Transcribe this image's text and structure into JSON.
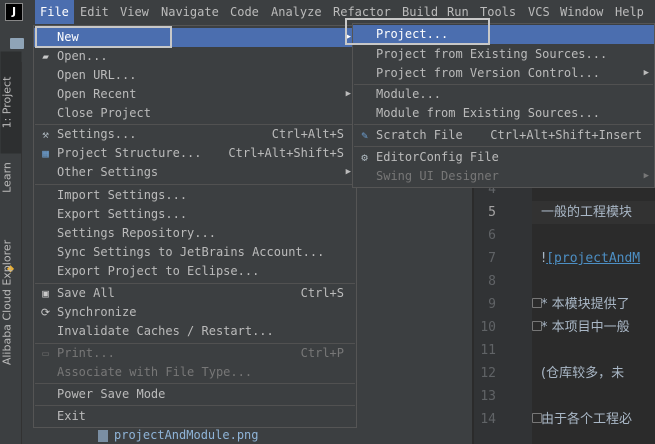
{
  "app": {
    "icon_letter": "J"
  },
  "menubar": {
    "items": [
      "File",
      "Edit",
      "View",
      "Navigate",
      "Code",
      "Analyze",
      "Refactor",
      "Build",
      "Run",
      "Tools",
      "VCS",
      "Window",
      "Help"
    ]
  },
  "toolwindows": {
    "project_tab": "1: Project",
    "learn_tab": "Learn",
    "alibaba_tab": "Alibaba Cloud Explorer"
  },
  "project_panel": {
    "file_name": "projectAndModule.png"
  },
  "file_menu": {
    "items": [
      {
        "label": "New",
        "shortcut": "",
        "submenu": true,
        "icon": "",
        "disabled": false,
        "highlighted": true
      },
      {
        "label": "Open...",
        "shortcut": "",
        "submenu": false,
        "icon": "folder-open-icon",
        "disabled": false
      },
      {
        "label": "Open URL...",
        "shortcut": "",
        "submenu": false,
        "icon": "",
        "disabled": false
      },
      {
        "label": "Open Recent",
        "shortcut": "",
        "submenu": true,
        "icon": "",
        "disabled": false
      },
      {
        "label": "Close Project",
        "shortcut": "",
        "submenu": false,
        "icon": "",
        "disabled": false
      },
      {
        "label": "Settings...",
        "shortcut": "Ctrl+Alt+S",
        "submenu": false,
        "icon": "wrench-icon",
        "disabled": false
      },
      {
        "label": "Project Structure...",
        "shortcut": "Ctrl+Alt+Shift+S",
        "submenu": false,
        "icon": "project-structure-icon",
        "disabled": false
      },
      {
        "label": "Other Settings",
        "shortcut": "",
        "submenu": true,
        "icon": "",
        "disabled": false
      },
      {
        "label": "Import Settings...",
        "shortcut": "",
        "submenu": false,
        "icon": "",
        "disabled": false
      },
      {
        "label": "Export Settings...",
        "shortcut": "",
        "submenu": false,
        "icon": "",
        "disabled": false
      },
      {
        "label": "Settings Repository...",
        "shortcut": "",
        "submenu": false,
        "icon": "",
        "disabled": false
      },
      {
        "label": "Sync Settings to JetBrains Account...",
        "shortcut": "",
        "submenu": false,
        "icon": "",
        "disabled": false
      },
      {
        "label": "Export Project to Eclipse...",
        "shortcut": "",
        "submenu": false,
        "icon": "",
        "disabled": false
      },
      {
        "label": "Save All",
        "shortcut": "Ctrl+S",
        "submenu": false,
        "icon": "save-icon",
        "disabled": false
      },
      {
        "label": "Synchronize",
        "shortcut": "",
        "submenu": false,
        "icon": "sync-icon",
        "disabled": false
      },
      {
        "label": "Invalidate Caches / Restart...",
        "shortcut": "",
        "submenu": false,
        "icon": "",
        "disabled": false
      },
      {
        "label": "Print...",
        "shortcut": "Ctrl+P",
        "submenu": false,
        "icon": "print-icon",
        "disabled": true
      },
      {
        "label": "Associate with File Type...",
        "shortcut": "",
        "submenu": false,
        "icon": "",
        "disabled": true
      },
      {
        "label": "Power Save Mode",
        "shortcut": "",
        "submenu": false,
        "icon": "",
        "disabled": false
      },
      {
        "label": "Exit",
        "shortcut": "",
        "submenu": false,
        "icon": "",
        "disabled": false
      }
    ]
  },
  "new_submenu": {
    "items": [
      {
        "label": "Project...",
        "shortcut": "",
        "submenu": false,
        "icon": "",
        "disabled": false,
        "highlighted": true
      },
      {
        "label": "Project from Existing Sources...",
        "shortcut": "",
        "submenu": false,
        "icon": "",
        "disabled": false
      },
      {
        "label": "Project from Version Control...",
        "shortcut": "",
        "submenu": true,
        "icon": "",
        "disabled": false
      },
      {
        "label": "Module...",
        "shortcut": "",
        "submenu": false,
        "icon": "",
        "disabled": false
      },
      {
        "label": "Module from Existing Sources...",
        "shortcut": "",
        "submenu": false,
        "icon": "",
        "disabled": false
      },
      {
        "label": "Scratch File",
        "shortcut": "Ctrl+Alt+Shift+Insert",
        "submenu": false,
        "icon": "scratch-file-icon",
        "disabled": false
      },
      {
        "label": "EditorConfig File",
        "shortcut": "",
        "submenu": false,
        "icon": "gear-icon",
        "disabled": false
      },
      {
        "label": "Swing UI Designer",
        "shortcut": "",
        "submenu": true,
        "icon": "",
        "disabled": true
      }
    ]
  },
  "editor": {
    "line_numbers": [
      "4",
      "5",
      "6",
      "7",
      "8",
      "9",
      "10",
      "11",
      "12",
      "13",
      "14"
    ],
    "current_line": "5",
    "lines": {
      "l5": "一般的工程模块",
      "l7_prefix": "!",
      "l7_link": "[projectAndM",
      "l9": "* 本模块提供了",
      "l10": "* 本项目中一般",
      "l12": "(仓库较多，未",
      "l14": "由于各个工程必"
    }
  },
  "colors": {
    "menu_bg": "#3c3f41",
    "highlight": "#4b6eaf",
    "editor_bg": "#2b2b2b",
    "link": "#4d8fc4"
  }
}
